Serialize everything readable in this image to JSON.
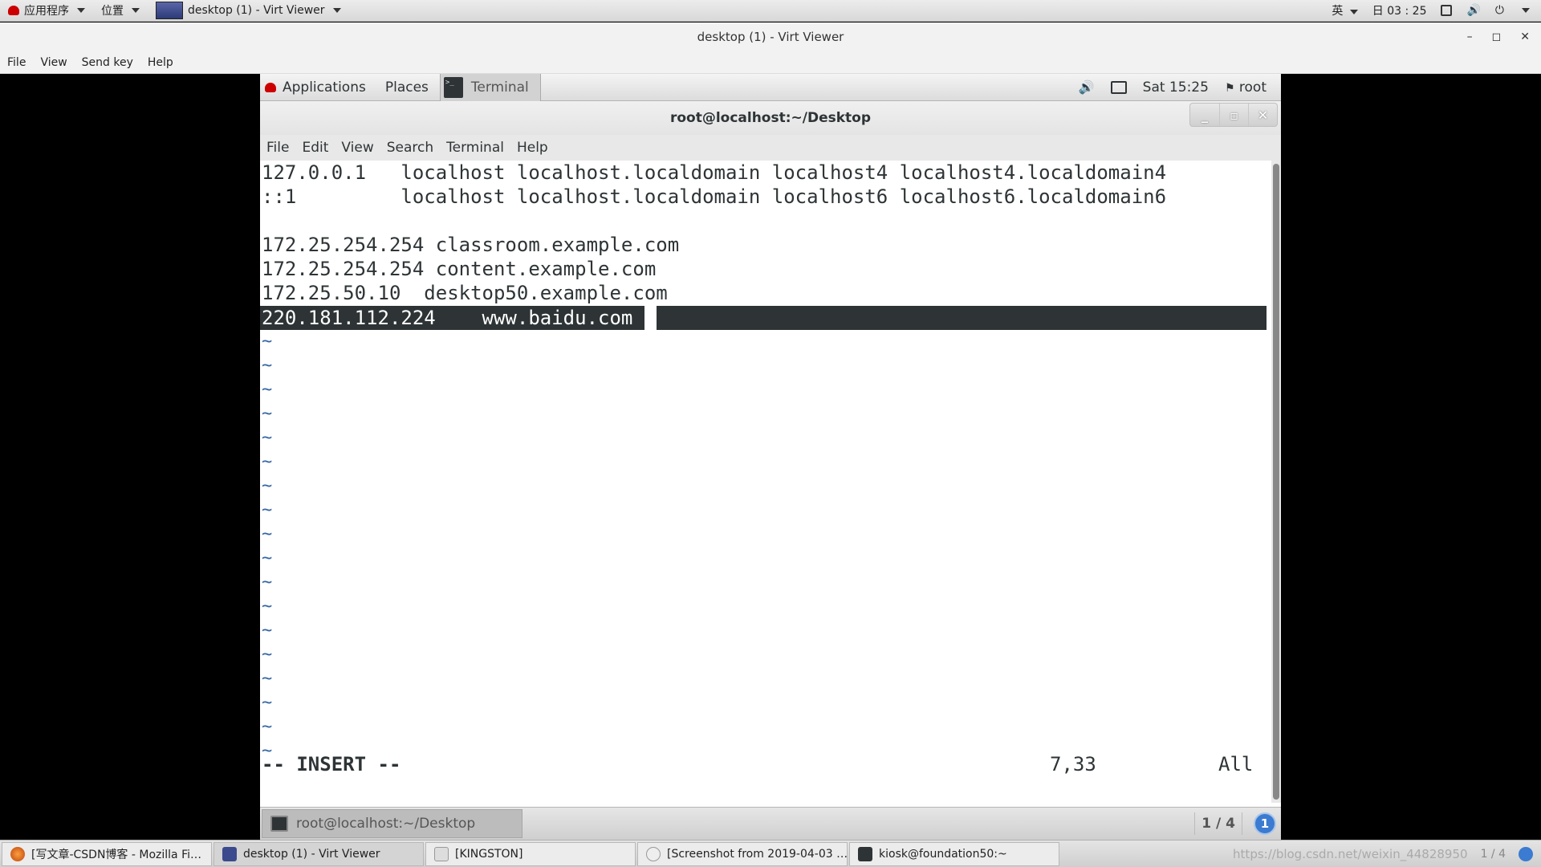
{
  "host_top": {
    "apps_label": "应用程序",
    "places_label": "位置",
    "window_label": "desktop (1) - Virt Viewer",
    "input_method": "英",
    "day": "日",
    "time": "03 : 25"
  },
  "viewer": {
    "title": "desktop (1) - Virt Viewer",
    "menu": [
      "File",
      "View",
      "Send key",
      "Help"
    ]
  },
  "guest_panel": {
    "applications": "Applications",
    "places": "Places",
    "terminal": "Terminal",
    "clock": "Sat 15:25",
    "user": "root"
  },
  "terminal": {
    "title": "root@localhost:~/Desktop",
    "menu": [
      "File",
      "Edit",
      "View",
      "Search",
      "Terminal",
      "Help"
    ],
    "lines": [
      "127.0.0.1   localhost localhost.localdomain localhost4 localhost4.localdomain4",
      "::1         localhost localhost.localdomain localhost6 localhost6.localdomain6",
      "",
      "172.25.254.254 classroom.example.com",
      "172.25.254.254 content.example.com",
      "172.25.50.10  desktop50.example.com",
      "220.181.112.224    www.baidu.com"
    ],
    "tilde": "~",
    "mode": "-- INSERT --",
    "position": "7,33",
    "scroll": "All"
  },
  "guest_bottom": {
    "task": "root@localhost:~/Desktop",
    "workspace": "1 / 4",
    "notifications": "1"
  },
  "host_taskbar": {
    "items": [
      "[写文章-CSDN博客 - Mozilla Fi…",
      "desktop (1) - Virt Viewer",
      "[KINGSTON]",
      "[Screenshot from 2019-04-03 …",
      "kiosk@foundation50:~"
    ],
    "watermark": "https://blog.csdn.net/weixin_44828950",
    "workspace": "1 / 4"
  }
}
